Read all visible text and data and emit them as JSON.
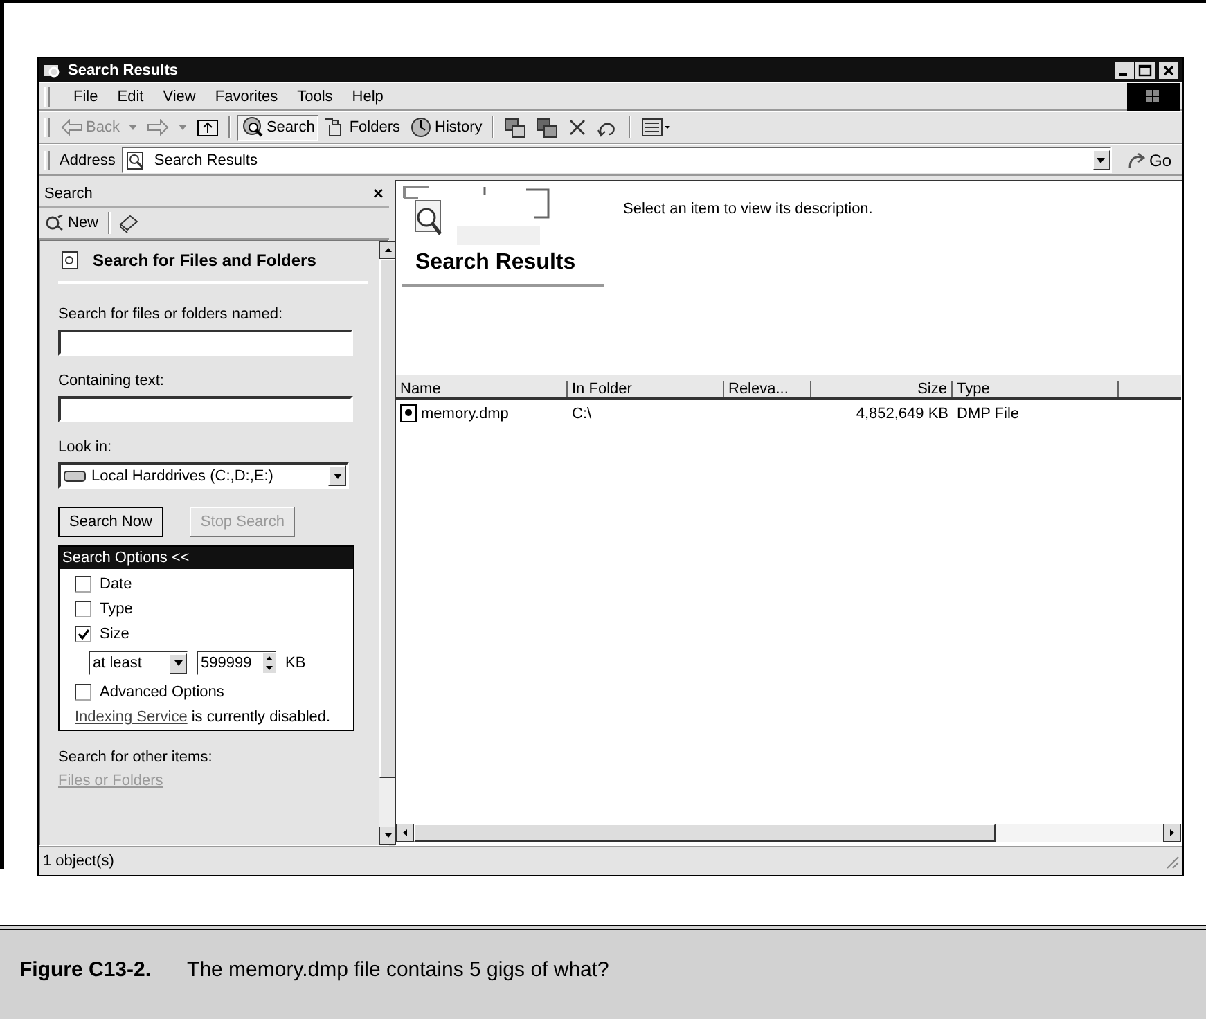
{
  "window": {
    "title": "Search Results"
  },
  "menu": [
    "File",
    "Edit",
    "View",
    "Favorites",
    "Tools",
    "Help"
  ],
  "toolbar": [
    {
      "kind": "back",
      "label": "Back",
      "pressed": false,
      "disabled": true
    },
    {
      "kind": "dropdown",
      "pressed": false,
      "disabled": true
    },
    {
      "kind": "forward",
      "pressed": false,
      "disabled": true
    },
    {
      "kind": "dropdown",
      "pressed": false,
      "disabled": true
    },
    {
      "kind": "up",
      "pressed": false,
      "disabled": false
    },
    {
      "kind": "separator"
    },
    {
      "kind": "search",
      "label": "Search",
      "pressed": true,
      "disabled": false
    },
    {
      "kind": "folders",
      "label": "Folders",
      "pressed": false,
      "disabled": false
    },
    {
      "kind": "history",
      "label": "History",
      "pressed": false,
      "disabled": false
    },
    {
      "kind": "separator"
    },
    {
      "kind": "move",
      "pressed": false,
      "disabled": false
    },
    {
      "kind": "copy",
      "pressed": false,
      "disabled": false
    },
    {
      "kind": "delete",
      "pressed": false,
      "disabled": false
    },
    {
      "kind": "undo",
      "pressed": false,
      "disabled": false
    },
    {
      "kind": "separator"
    },
    {
      "kind": "views",
      "pressed": false,
      "disabled": false
    }
  ],
  "address": {
    "label": "Address",
    "value": "Search Results",
    "go": "Go"
  },
  "search_pane": {
    "title": "Search",
    "close": "×",
    "new": "New",
    "heading": "Search for Files and Folders",
    "name_label": "Search for files or folders named:",
    "text_label": "Containing text:",
    "look_in_label": "Look in:",
    "look_in": "Local Harddrives (C:,D:,E:)",
    "search_now": {
      "label": "Search Now",
      "disabled": false
    },
    "stop_search": {
      "label": "Stop Search",
      "disabled": true
    },
    "options": {
      "title": "Search Options <<",
      "items": [
        {
          "kind": "checkbox",
          "label": "Date",
          "checked": false
        },
        {
          "kind": "checkbox",
          "label": "Type",
          "checked": false
        },
        {
          "kind": "checkbox",
          "label": "Size",
          "checked": true
        },
        {
          "kind": "size",
          "comparison": "at least",
          "value": "599999",
          "unit": "KB"
        },
        {
          "kind": "checkbox",
          "label": "Advanced Options",
          "checked": false
        }
      ],
      "indexing_link": "Indexing Service",
      "indexing_text": "is currently disabled."
    },
    "other_label": "Search for other items:",
    "other_link": "Files or Folders"
  },
  "results": {
    "description": "Select an item to view its description.",
    "heading": "Search Results",
    "columns": [
      "Name",
      "In Folder",
      "Releva...",
      "Size",
      "Type"
    ],
    "rows": [
      {
        "name": "memory.dmp",
        "folder": "C:\\",
        "size": "4,852,649 KB",
        "type": "DMP File"
      }
    ]
  },
  "status_bar": "1 object(s)",
  "caption": {
    "label": "Figure C13-2.",
    "text": "The memory.dmp file contains 5 gigs of what?"
  }
}
